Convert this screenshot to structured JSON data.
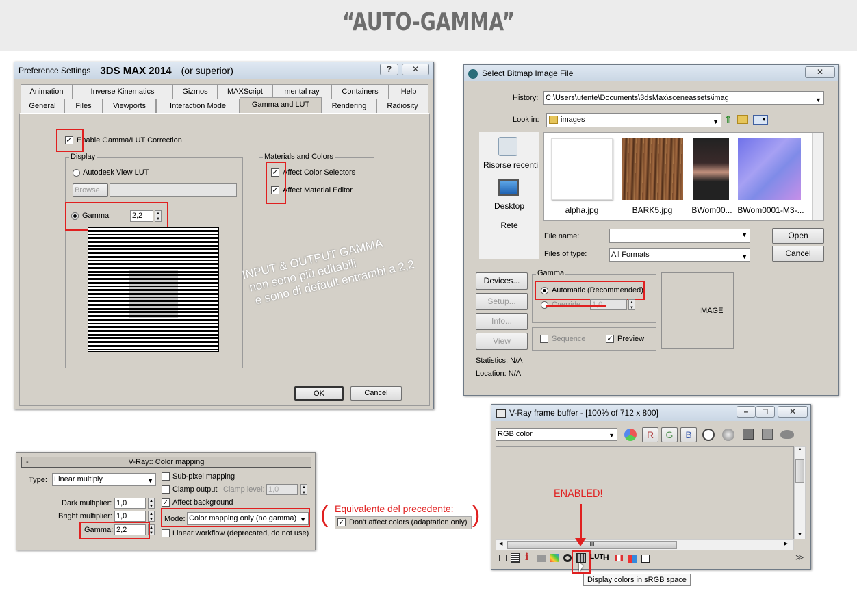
{
  "banner": {
    "title": "“AUTO-GAMMA”"
  },
  "prefs": {
    "title": "Preference Settings",
    "product": "3DS MAX 2014",
    "version_note": "(or superior)",
    "help_btn": "?",
    "close_btn": "✕",
    "tabs_row1": [
      "Animation",
      "Inverse Kinematics",
      "Gizmos",
      "MAXScript",
      "mental ray",
      "Containers",
      "Help"
    ],
    "tabs_row2": [
      "General",
      "Files",
      "Viewports",
      "Interaction Mode",
      "Gamma and LUT",
      "Rendering",
      "Radiosity"
    ],
    "enable_label": "Enable Gamma/LUT Correction",
    "display_group": "Display",
    "autodesk_lut": "Autodesk View LUT",
    "browse_btn": "Browse...",
    "gamma_label": "Gamma",
    "gamma_value": "2,2",
    "materials_group": "Materials and Colors",
    "affect_color": "Affect Color Selectors",
    "affect_material": "Affect Material Editor",
    "ok_btn": "OK",
    "cancel_btn": "Cancel"
  },
  "annotation": {
    "line1": "INPUT & OUTPUT GAMMA",
    "line2": "non sono più editabili",
    "line3": "e sono di default entrambi a 2,2"
  },
  "bitmap": {
    "title": "Select Bitmap Image File",
    "close_btn": "✕",
    "history_label": "History:",
    "history_value": "C:\\Users\\utente\\Documents\\3dsMax\\sceneassets\\imag",
    "lookin_label": "Look in:",
    "lookin_value": "images",
    "places": [
      "Risorse recenti",
      "Desktop",
      "Rete"
    ],
    "files": [
      "alpha.jpg",
      "BARK5.jpg",
      "BWom00...",
      "BWom0001-M3-..."
    ],
    "filename_label": "File name:",
    "filetype_label": "Files of type:",
    "filetype_value": "All Formats",
    "open_btn": "Open",
    "cancel_btn": "Cancel",
    "devices_btn": "Devices...",
    "setup_btn": "Setup...",
    "info_btn": "Info...",
    "view_btn": "View",
    "gamma_group": "Gamma",
    "automatic": "Automatic (Recommended)",
    "override": "Override",
    "override_value": "1,0",
    "sequence": "Sequence",
    "preview": "Preview",
    "image_label": "IMAGE",
    "statistics": "Statistics:  N/A",
    "location": "Location:  N/A"
  },
  "colormap": {
    "header": "V-Ray:: Color mapping",
    "collapse": "-",
    "type_label": "Type:",
    "type_value": "Linear multiply",
    "dark_label": "Dark multiplier:",
    "dark_value": "1,0",
    "bright_label": "Bright multiplier:",
    "bright_value": "1,0",
    "gamma_label": "Gamma:",
    "gamma_value": "2,2",
    "subpixel": "Sub-pixel mapping",
    "clamp": "Clamp output",
    "clamp_level_label": "Clamp level:",
    "clamp_level_value": "1,0",
    "affect_bg": "Affect background",
    "mode_label": "Mode:",
    "mode_value": "Color mapping only (no gamma)",
    "linear_wf": "Linear workflow (deprecated, do not use)"
  },
  "equivalent": {
    "title": "Equivalente del precedente:",
    "checkbox": "Don't affect colors (adaptation only)"
  },
  "vfb": {
    "title": "V-Ray frame buffer - [100% of 712 x 800]",
    "channel": "RGB color",
    "r": "R",
    "g": "G",
    "b": "B",
    "enabled": "ENABLED!",
    "tooltip": "Display colors in sRGB space",
    "scroll_mark": "III"
  },
  "colors": {
    "highlight_red": "#e02020",
    "banner_text": "#6d6d6d",
    "window_face": "#d4d0c8"
  }
}
